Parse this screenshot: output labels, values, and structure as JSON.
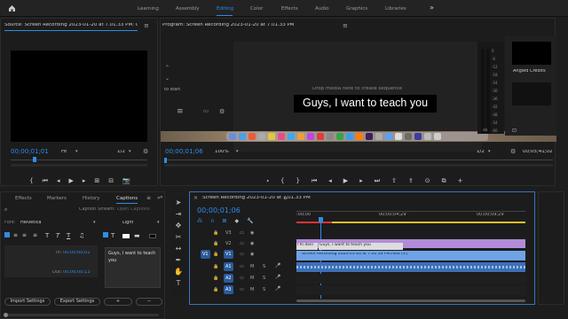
{
  "workspaces": {
    "home": "home-icon",
    "tabs": [
      "Learning",
      "Assembly",
      "Editing",
      "Color",
      "Effects",
      "Audio",
      "Graphics",
      "Libraries"
    ],
    "active": "Editing",
    "more": "»"
  },
  "source": {
    "title": "Source: Screen Recording 2023-01-20 at 7.01.33 PM: Open C",
    "timecode": "00;00;01;01",
    "fit": "Fit",
    "resolution": "1/2"
  },
  "program": {
    "title": "Program: Screen Recording 2023-01-20 at 7.01.33 PM",
    "drop_text": "Drop media here to create sequence",
    "start_text": "to start",
    "caption_text": "Guys, I want to teach you",
    "timecode": "00;00;01;06",
    "zoom": "100%",
    "resolution": "1/2",
    "duration": "00;05;41;02",
    "side_title": "Angled Credits",
    "meter_labels": [
      "0",
      "-6",
      "-12",
      "-18",
      "-24",
      "-30",
      "-36",
      "-42",
      "-48",
      "-54",
      "-60"
    ],
    "meter_bottom": "dB"
  },
  "captions_panel": {
    "tabs": [
      "Effects",
      "Markers",
      "History",
      "Captions"
    ],
    "active": "Captions",
    "stream_label": "Caption Stream:",
    "stream_value": "Open Captions",
    "font_label": "Font:",
    "font_value": "Helvetica",
    "weight_value": "Light",
    "in_label": "In:",
    "in_value": "00;00;00;02",
    "out_label": "Out:",
    "out_value": "00;00;00;13",
    "caption_text": "Guys, I want to teach you",
    "import_button": "Import Settings",
    "export_button": "Export Settings",
    "add_button": "+",
    "remove_button": "−"
  },
  "timeline": {
    "title": "Screen Recording 2023-01-20 at 7.01.33 PM",
    "timecode": "00;00;01;06",
    "ruler": [
      ":00;00",
      "00;00;04;29",
      "00;00;09;29"
    ],
    "tracks": [
      "V3",
      "V2",
      "V1",
      "A1",
      "A2",
      "A3"
    ],
    "source_patch": [
      "V1",
      "A1"
    ],
    "mute": "M",
    "solo": "S",
    "caption_clip_1": "I'm doin",
    "caption_clip_2": "Guys, I want to teach you",
    "video_clip": "Screen Recording 2023-01-20 at 7.01.33 PM.mov [V]"
  },
  "colors": {
    "accent": "#2d8ceb",
    "caption_track": "#b28bd8",
    "video_clip": "#6fa3e6",
    "audio_clip": "#3e6fb5",
    "work_area": "#d33"
  }
}
